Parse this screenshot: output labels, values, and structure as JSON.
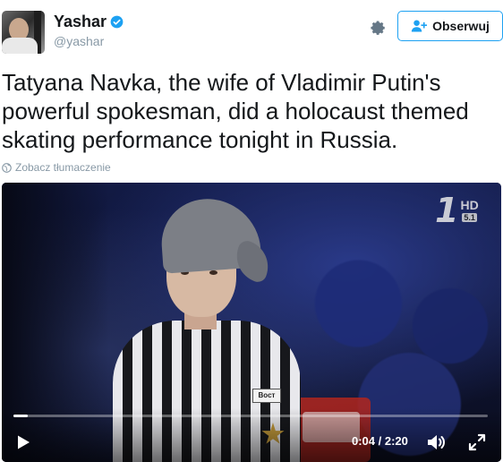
{
  "author": {
    "display_name": "Yashar",
    "handle": "@yashar",
    "verified": true
  },
  "actions": {
    "follow_label": "Obserwuj"
  },
  "tweet": {
    "text": "Tatyana Navka, the wife of Vladimir Putin's powerful spokesman, did a holocaust themed skating performance tonight in Russia.",
    "translate_label": "Zobacz tłumaczenie"
  },
  "video": {
    "channel_logo": "1",
    "channel_hd": "HD",
    "channel_surround": "5.1",
    "badge_text": "Вост",
    "time_display": "0:04 / 2:20",
    "progress_fraction": 0.03
  },
  "icons": {
    "verified": "verified-badge-icon",
    "settings": "gear-icon",
    "follow": "add-user-icon",
    "translate": "globe-icon",
    "play": "play-icon",
    "volume": "volume-icon",
    "fullscreen": "fullscreen-icon"
  },
  "colors": {
    "accent": "#1da1f2",
    "text": "#14171a",
    "muted": "#8899a6"
  }
}
